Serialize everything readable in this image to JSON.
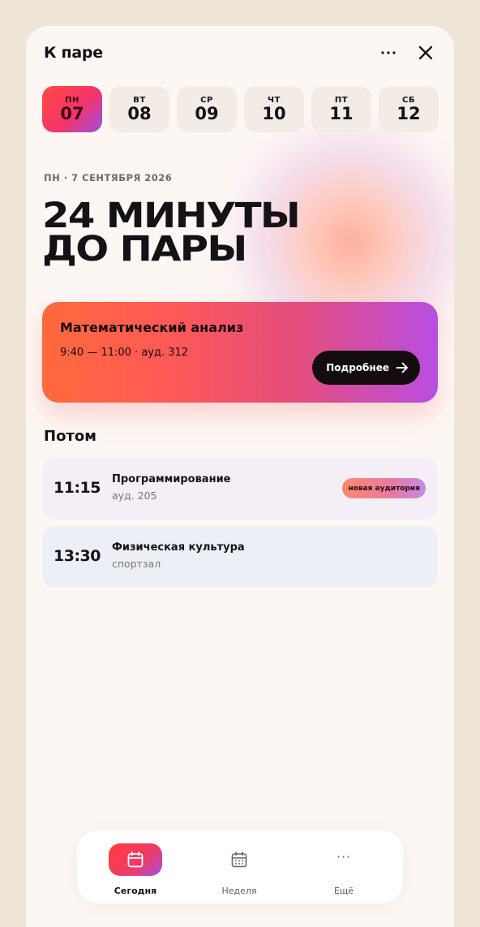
{
  "header": {
    "title": "К паре",
    "more_icon": "more-horizontal-icon",
    "close_icon": "close-icon"
  },
  "days": [
    {
      "name": "ПН",
      "num": "07",
      "active": true
    },
    {
      "name": "ВТ",
      "num": "08",
      "active": false
    },
    {
      "name": "СР",
      "num": "09",
      "active": false
    },
    {
      "name": "ЧТ",
      "num": "10",
      "active": false
    },
    {
      "name": "ПТ",
      "num": "11",
      "active": false
    },
    {
      "name": "СБ",
      "num": "12",
      "active": false
    }
  ],
  "hero": {
    "date_line": "ПН · 7 СЕНТЯБРЯ 2026",
    "countdown_line1": "24 минуты",
    "countdown_line2": "до пары"
  },
  "next_class": {
    "title": "Математический анализ",
    "subtitle": "9:40 — 11:00 · ауд. 312",
    "button_label": "Подробнее",
    "button_icon": "arrow-right-icon"
  },
  "later": {
    "title": "Потом",
    "items": [
      {
        "time": "11:15",
        "name": "Программирование",
        "room": "ауд. 205",
        "badge": "новая аудитория"
      },
      {
        "time": "13:30",
        "name": "Физическая культура",
        "room": "спортзал"
      }
    ]
  },
  "tabbar": {
    "items": [
      {
        "label": "Сегодня",
        "icon": "calendar-icon",
        "active": true
      },
      {
        "label": "Неделя",
        "icon": "calendar-grid-icon",
        "active": false
      },
      {
        "label": "Ещё",
        "icon": "more-horizontal-icon",
        "active": false
      }
    ],
    "more_glyph": "···"
  },
  "colors": {
    "accent_start": "#ff4a3e",
    "accent_mid": "#f5346a",
    "accent_end": "#9a4fe0",
    "background": "#efe6d8",
    "panel": "#fdf7f3"
  }
}
